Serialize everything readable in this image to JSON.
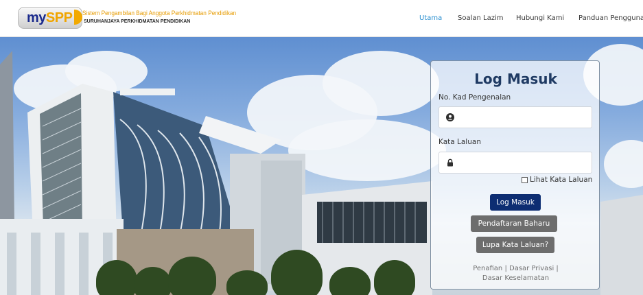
{
  "brand": {
    "logo_my": "my",
    "logo_spp": "SPP",
    "tagline": "Sistem Pengambilan Bagi Anggota Perkhidmatan Pendidikan",
    "agency": "SURUHANJAYA PERKHIDMATAN PENDIDIKAN"
  },
  "nav": {
    "items": [
      {
        "label": "Utama",
        "active": true
      },
      {
        "label": "Soalan Lazim",
        "active": false
      },
      {
        "label": "Hubungi Kami",
        "active": false
      },
      {
        "label": "Panduan Pengguna",
        "active": false
      }
    ]
  },
  "login": {
    "title": "Log Masuk",
    "ic_label": "No. Kad Pengenalan",
    "ic_value": "",
    "ic_icon": "user-circle-icon",
    "password_label": "Kata Laluan",
    "password_value": "",
    "password_icon": "lock-icon",
    "show_password_label": "Lihat Kata Laluan",
    "show_password_checked": false,
    "login_button": "Log Masuk",
    "register_button": "Pendaftaran Baharu",
    "forgot_button": "Lupa Kata Laluan?",
    "footer": {
      "disclaimer": "Penafian",
      "sep1": "|",
      "privacy": "Dasar Privasi",
      "sep2": "|",
      "security": "Dasar Keselamatan"
    }
  },
  "colors": {
    "nav_active": "#2b8fd0",
    "primary_button": "#0d2d72",
    "secondary_button": "#6d6d6d",
    "title": "#1f3a63",
    "logo_blue": "#1b2a8c",
    "logo_orange": "#f0a500"
  }
}
